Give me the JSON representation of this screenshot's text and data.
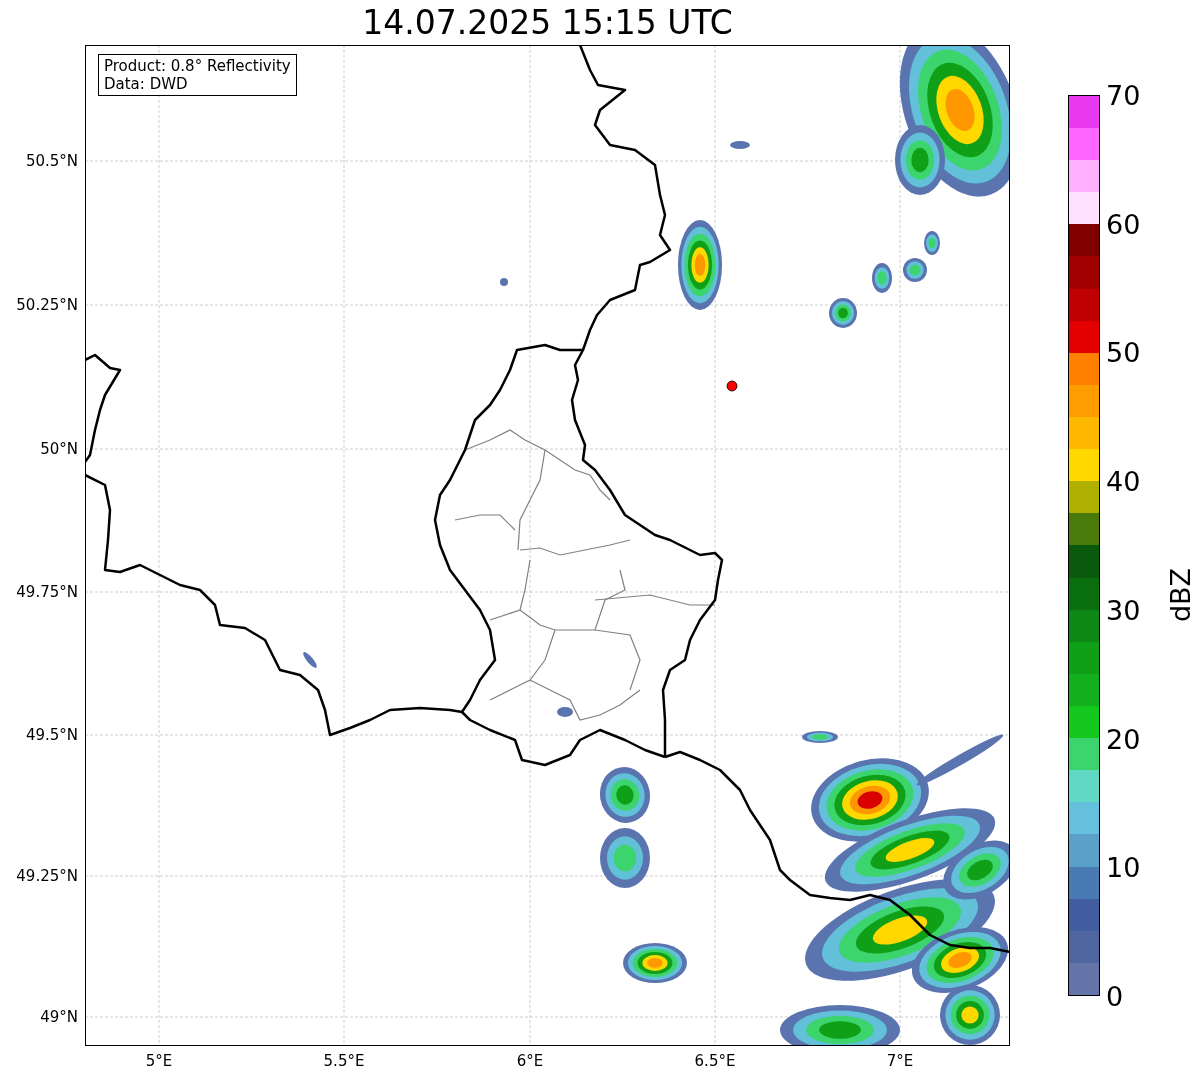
{
  "title": "14.07.2025 15:15 UTC",
  "info_box": [
    "Product: 0.8° Reflectivity",
    "Data: DWD"
  ],
  "map": {
    "x_ticks": [
      "5°E",
      "5.5°E",
      "6°E",
      "6.5°E",
      "7°E"
    ],
    "y_ticks": [
      "50.5°N",
      "50.25°N",
      "50°N",
      "49.75°N",
      "49.5°N",
      "49.25°N",
      "49°N"
    ]
  },
  "colorbar": {
    "label": "dBZ",
    "ticks": [
      "70",
      "60",
      "50",
      "40",
      "30",
      "20",
      "10",
      "0"
    ],
    "segments": [
      {
        "color": "#6474a8"
      },
      {
        "color": "#5066a0"
      },
      {
        "color": "#425ca0"
      },
      {
        "color": "#4a7ab4"
      },
      {
        "color": "#5aa0c8"
      },
      {
        "color": "#64c0dc"
      },
      {
        "color": "#60d8c4"
      },
      {
        "color": "#3cd46c"
      },
      {
        "color": "#14c81e"
      },
      {
        "color": "#12b01c"
      },
      {
        "color": "#10a018"
      },
      {
        "color": "#0d8814"
      },
      {
        "color": "#0a700e"
      },
      {
        "color": "#0a5a0e"
      },
      {
        "color": "#4a7a0a"
      },
      {
        "color": "#b0b000"
      },
      {
        "color": "#ffd800"
      },
      {
        "color": "#ffb800"
      },
      {
        "color": "#ff9c00"
      },
      {
        "color": "#ff7f00"
      },
      {
        "color": "#e40000"
      },
      {
        "color": "#c00000"
      },
      {
        "color": "#a00000"
      },
      {
        "color": "#800000"
      },
      {
        "color": "#ffe0ff"
      },
      {
        "color": "#ffb0ff"
      },
      {
        "color": "#ff66ff"
      },
      {
        "color": "#e838f0"
      }
    ]
  }
}
